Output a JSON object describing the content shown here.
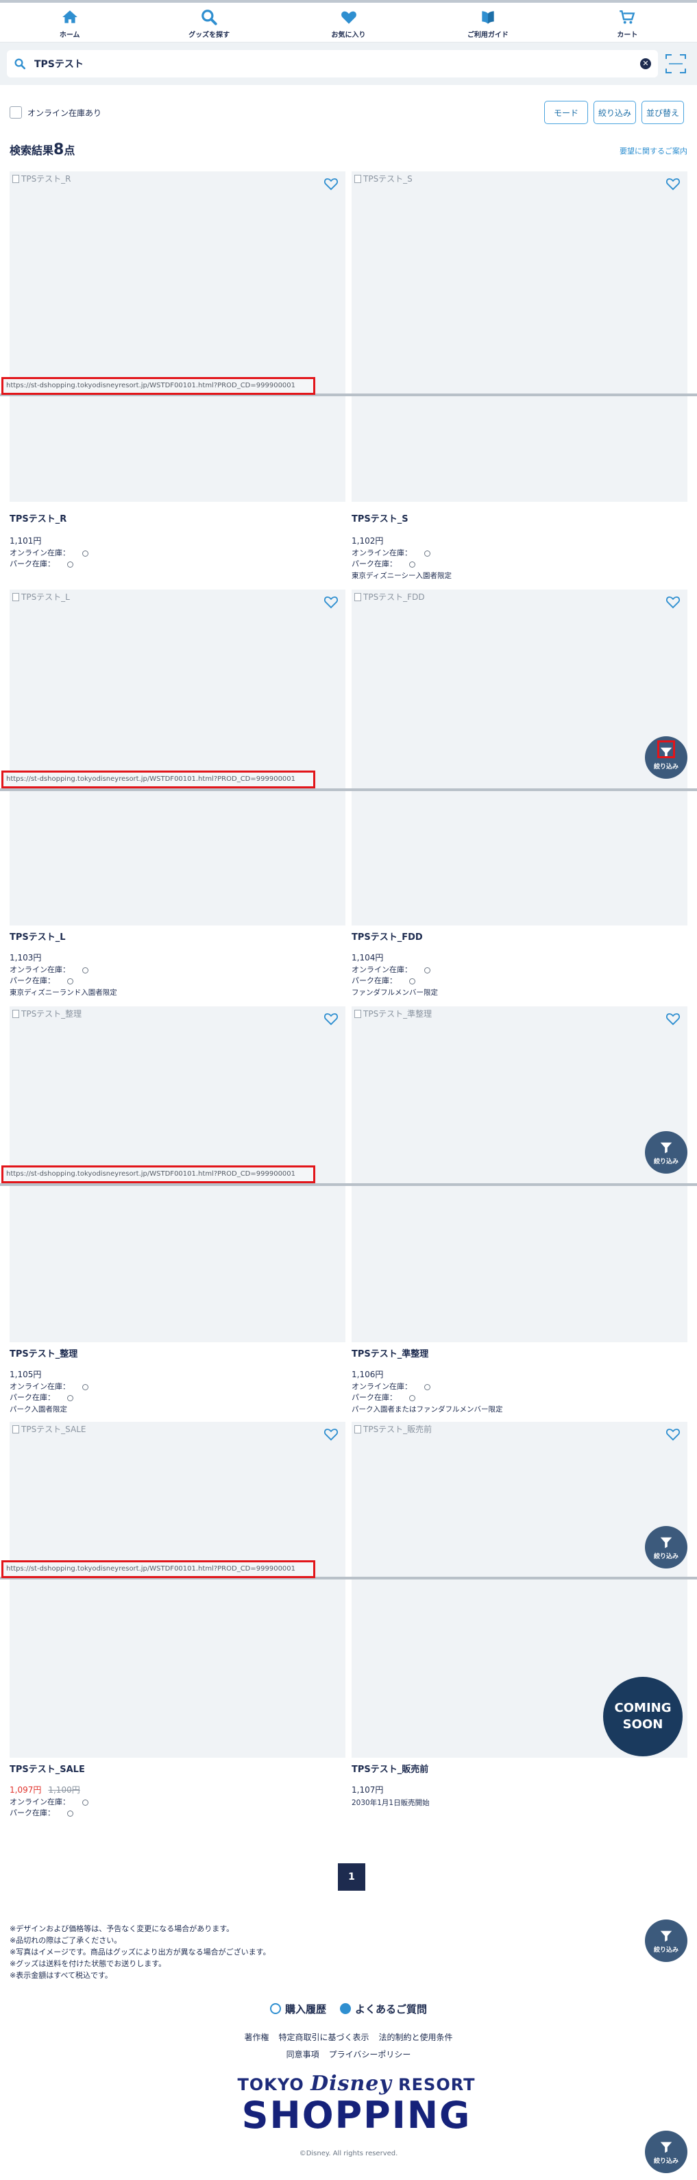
{
  "nav": {
    "home": "ホーム",
    "search": "グッズを探す",
    "favorites": "お気に入り",
    "guide": "ご利用ガイド",
    "cart": "カート"
  },
  "search": {
    "value": "TPSテスト",
    "scan_label": "検索"
  },
  "filters": {
    "online_stock": "オンライン在庫あり",
    "mode": "モード",
    "narrow": "絞り込み",
    "sort": "並び替え"
  },
  "results": {
    "label": "検索結果",
    "count": "8",
    "unit": "点",
    "related_link": "要望に関するご案内"
  },
  "stock_labels": {
    "online": "オンライン在庫：",
    "park": "パーク在庫："
  },
  "url_text": "https://st-dshopping.tokyodisneyresort.jp/WSTDF00101.html?PROD_CD=999900001",
  "fab_label": "絞り込み",
  "coming_soon": {
    "line1": "COMING",
    "line2": "SOON"
  },
  "products": [
    {
      "alt": "TPSテスト_R",
      "name": "TPSテスト_R",
      "price": "1,101円",
      "note": ""
    },
    {
      "alt": "TPSテスト_S",
      "name": "TPSテスト_S",
      "price": "1,102円",
      "note": "東京ディズニーシー入園者限定"
    },
    {
      "alt": "TPSテスト_L",
      "name": "TPSテスト_L",
      "price": "1,103円",
      "note": "東京ディズニーランド入園者限定"
    },
    {
      "alt": "TPSテスト_FDD",
      "name": "TPSテスト_FDD",
      "price": "1,104円",
      "note": "ファンダフルメンバー限定"
    },
    {
      "alt": "TPSテスト_整理",
      "name": "TPSテスト_整理",
      "price": "1,105円",
      "note": "パーク入園者限定"
    },
    {
      "alt": "TPSテスト_準整理",
      "name": "TPSテスト_準整理",
      "price": "1,106円",
      "note": "パーク入園者またはファンダフルメンバー限定"
    },
    {
      "alt": "TPSテスト_SALE",
      "name": "TPSテスト_SALE",
      "price": "1,097円",
      "original_price": "1,100円",
      "note": ""
    },
    {
      "alt": "TPSテスト_販売前",
      "name": "TPSテスト_販売前",
      "price": "1,107円",
      "note": "2030年1月1日販売開始"
    }
  ],
  "pagination": {
    "current": "1"
  },
  "notes": [
    "※デザインおよび価格等は、予告なく変更になる場合があります。",
    "※品切れの際はご了承ください。",
    "※写真はイメージです。商品はグッズにより出方が異なる場合がございます。",
    "※グッズは送料を付けた状態でお送りします。",
    "※表示金額はすべて税込です。"
  ],
  "footer": {
    "history": "購入履歴",
    "faq": "よくあるご質問",
    "links_row1": [
      "著作権",
      "特定商取引に基づく表示",
      "法的制約と使用条件"
    ],
    "links_row2": [
      "同意事項",
      "プライバシーポリシー"
    ],
    "logo_line1a": "TOKYO",
    "logo_line1b": "Disney",
    "logo_line1c": "RESORT",
    "logo_line2": "SHOPPING",
    "copyright": "©Disney. All rights reserved."
  },
  "colors": {
    "navy": "#1d2b4f",
    "accent": "#4aa3df",
    "sale": "#e0312a",
    "highlight": "#e2151a"
  }
}
